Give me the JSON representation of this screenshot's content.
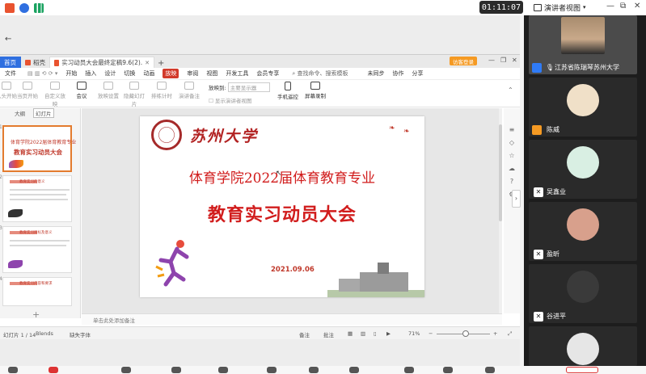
{
  "system": {
    "clock": "01:11:07",
    "presenter_view_label": "演讲者视图"
  },
  "wps": {
    "tabs": [
      {
        "label": "首页"
      },
      {
        "label": "稻壳"
      },
      {
        "label": "实习动员大会最终定稿9.6(2).ppt"
      }
    ],
    "login_label": "访客登录",
    "menu": [
      "文件",
      "开始",
      "插入",
      "设计",
      "切换",
      "动画",
      "放映",
      "审阅",
      "视图",
      "开发工具",
      "会员专享"
    ],
    "menu_active": "放映",
    "search_placeholder": "查找命令、搜索模板",
    "top_right": [
      "未同步",
      "协作",
      "分享"
    ],
    "ribbon": [
      {
        "label": "从头开始",
        "enabled": false
      },
      {
        "label": "当页开始",
        "enabled": false
      },
      {
        "label": "自定义放映",
        "enabled": false
      },
      {
        "label": "会议",
        "enabled": true
      },
      {
        "label": "放映设置",
        "enabled": false
      },
      {
        "label": "隐藏幻灯片",
        "enabled": false
      },
      {
        "label": "排练计时",
        "enabled": false
      },
      {
        "label": "演讲备注",
        "enabled": false
      },
      {
        "label": "手机遥控",
        "enabled": true
      },
      {
        "label": "屏幕录制",
        "enabled": true
      }
    ],
    "display_label": "放映到:",
    "display_value": "主要显示器",
    "show_presenter_view": "显示演讲者视图",
    "panel_tabs": [
      "大纲",
      "幻灯片"
    ],
    "notes_placeholder": "单击此处添加备注",
    "status": {
      "slide_counter": "幻灯片 1 / 14",
      "theme": "Blends",
      "font_missing": "缺失字体",
      "notes": "备注",
      "comments": "批注",
      "zoom": "71%"
    }
  },
  "slide": {
    "callig": "苏州大学",
    "line1": "体育学院2022届体育教育专业",
    "line2": "教育实习动员大会",
    "date": "2021.09.06"
  },
  "thumbs": [
    {
      "num": "1",
      "t1": "体育学院2022届体育教育专业",
      "t2": "教育实习动员大会"
    },
    {
      "num": "2",
      "head": "教育实习的意义"
    },
    {
      "num": "3",
      "head": "教育实习目标及意义"
    },
    {
      "num": "4",
      "head": "教育实习内容和要求"
    }
  ],
  "participants": [
    {
      "name": "江苏省陈瑞琴苏州大学",
      "color": "#c9a98a"
    },
    {
      "name": "陈威",
      "color": "#f0e0c8"
    },
    {
      "name": "吴鑫业",
      "color": "#d9efe3"
    },
    {
      "name": "盈昕",
      "color": "#d8a08c"
    },
    {
      "name": "谷进平",
      "color": "#2a2a2a"
    },
    {
      "name": "",
      "color": "#e6e6e6"
    }
  ]
}
